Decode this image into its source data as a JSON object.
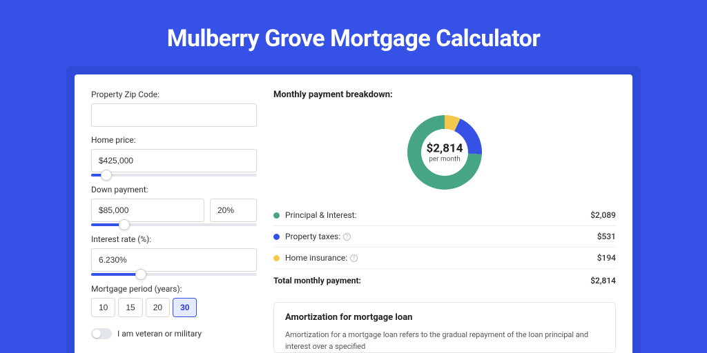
{
  "title": "Mulberry Grove Mortgage Calculator",
  "form": {
    "zip_label": "Property Zip Code:",
    "zip_value": "",
    "home_price_label": "Home price:",
    "home_price_value": "$425,000",
    "home_price_slider_pct": 9,
    "down_payment_label": "Down payment:",
    "down_payment_amount": "$85,000",
    "down_payment_percent": "20%",
    "down_payment_slider_pct": 20,
    "interest_label": "Interest rate (%):",
    "interest_value": "6.230%",
    "interest_slider_pct": 30,
    "period_label": "Mortgage period (years):",
    "periods": [
      "10",
      "15",
      "20",
      "30"
    ],
    "period_active_index": 3,
    "veteran_label": "I am veteran or military"
  },
  "breakdown": {
    "title": "Monthly payment breakdown:",
    "donut_amount": "$2,814",
    "donut_sub": "per month",
    "items": [
      {
        "label": "Principal & Interest:",
        "value": "$2,089",
        "percent": 74.2,
        "has_info": false,
        "color": "#46a583"
      },
      {
        "label": "Property taxes:",
        "value": "$531",
        "percent": 18.9,
        "has_info": true,
        "color": "#3651e6"
      },
      {
        "label": "Home insurance:",
        "value": "$194",
        "percent": 6.9,
        "has_info": true,
        "color": "#f2c94c"
      }
    ],
    "total_label": "Total monthly payment:",
    "total_value": "$2,814"
  },
  "amortization": {
    "title": "Amortization for mortgage loan",
    "text": "Amortization for a mortgage loan refers to the gradual repayment of the loan principal and interest over a specified"
  },
  "chart_data": {
    "type": "pie",
    "title": "Monthly payment breakdown",
    "categories": [
      "Principal & Interest",
      "Property taxes",
      "Home insurance"
    ],
    "values": [
      2089,
      531,
      194
    ],
    "colors": [
      "#46a583",
      "#3651e6",
      "#f2c94c"
    ],
    "center_label": "$2,814 per month"
  }
}
